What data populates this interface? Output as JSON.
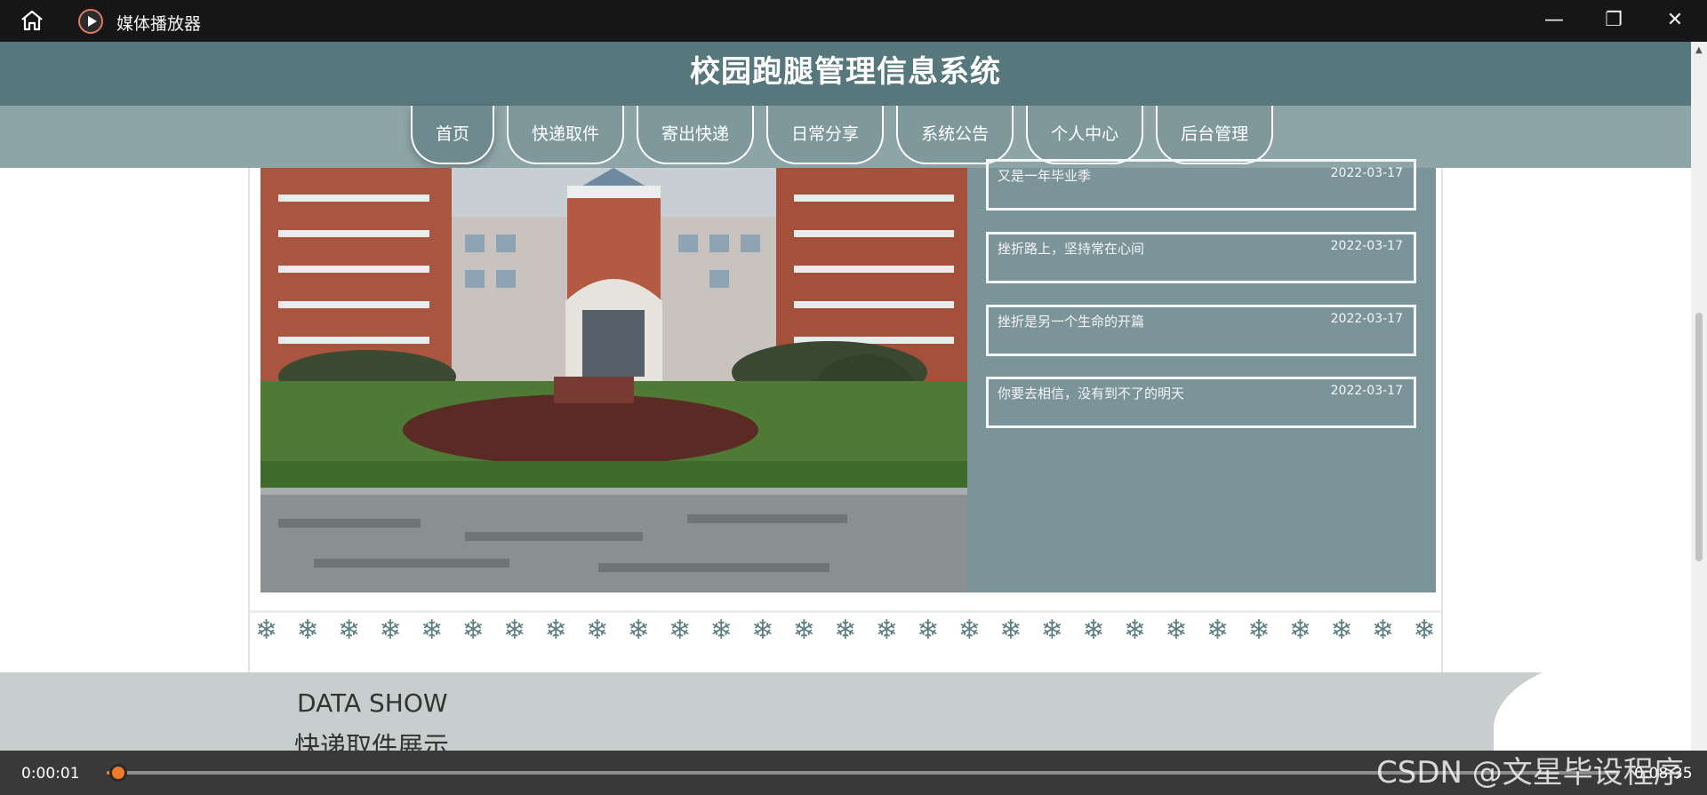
{
  "player": {
    "title": "媒体播放器",
    "icons": {
      "home": "home-icon",
      "app": "play-circle-icon",
      "minimize": "minimize-icon",
      "maximize": "restore-icon",
      "close": "close-icon"
    },
    "current_time": "0:00:01",
    "total_time": "0:08:35",
    "progress_fraction": 0.002,
    "accent_color": "#f07a28"
  },
  "site": {
    "title": "校园跑腿管理信息系统",
    "nav": [
      {
        "label": "首页"
      },
      {
        "label": "快递取件"
      },
      {
        "label": "寄出快递"
      },
      {
        "label": "日常分享"
      },
      {
        "label": "系统公告"
      },
      {
        "label": "个人中心"
      },
      {
        "label": "后台管理"
      }
    ],
    "header_color": "#56787d",
    "nav_color": "#8ea5a8"
  },
  "notices": [
    {
      "title": "又是一年毕业季",
      "date": "2022-03-17"
    },
    {
      "title": "挫折路上，坚持常在心间",
      "date": "2022-03-17"
    },
    {
      "title": "挫折是另一个生命的开篇",
      "date": "2022-03-17"
    },
    {
      "title": "你要去相信，没有到不了的明天",
      "date": "2022-03-17"
    }
  ],
  "data_show": {
    "heading_en": "DATA SHOW",
    "heading_cn": "快递取件展示"
  },
  "watermark": "CSDN @文星毕设程序"
}
